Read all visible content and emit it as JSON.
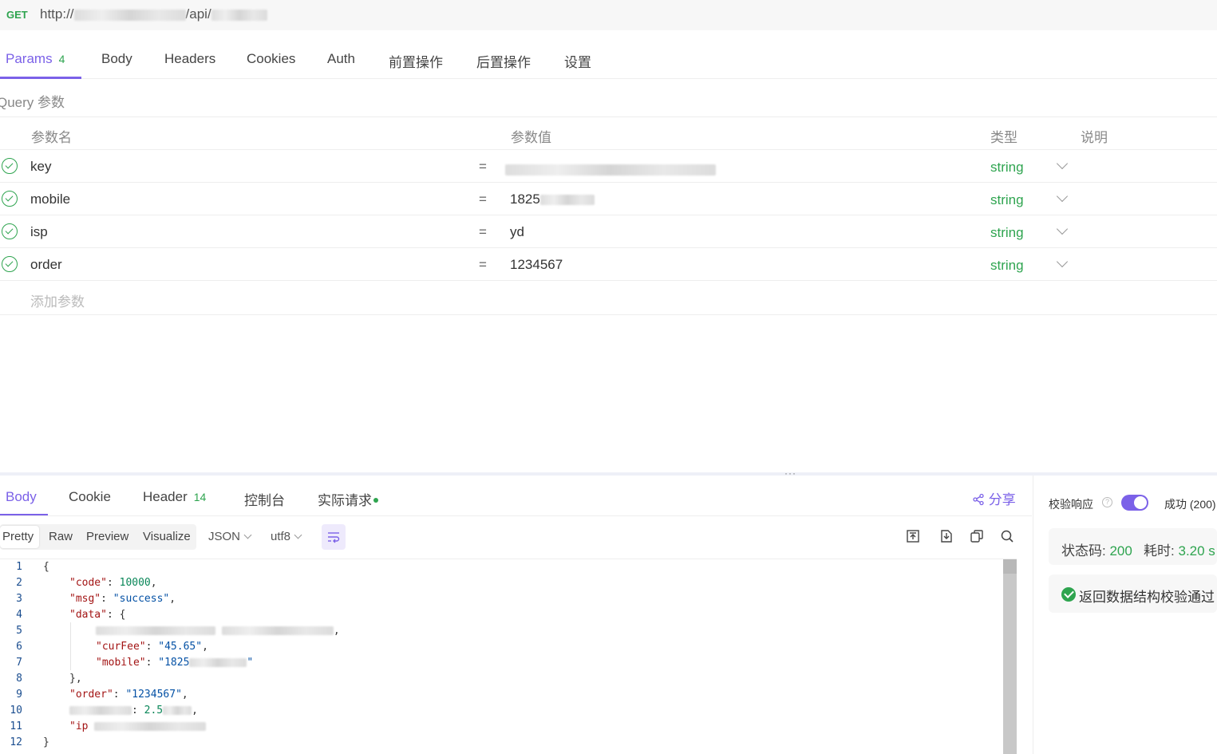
{
  "request": {
    "method": "GET",
    "url_prefix": "http://",
    "url_mid": "/api/"
  },
  "req_tabs": [
    {
      "label": "Params",
      "badge": "4"
    },
    {
      "label": "Body"
    },
    {
      "label": "Headers"
    },
    {
      "label": "Cookies"
    },
    {
      "label": "Auth"
    },
    {
      "label": "前置操作"
    },
    {
      "label": "后置操作"
    },
    {
      "label": "设置"
    }
  ],
  "query_label": "Query 参数",
  "columns": {
    "name": "参数名",
    "value": "参数值",
    "type": "类型",
    "desc": "说明"
  },
  "params": [
    {
      "name": "key",
      "eq": "=",
      "value": "",
      "type": "string"
    },
    {
      "name": "mobile",
      "eq": "=",
      "value": "1825",
      "type": "string"
    },
    {
      "name": "isp",
      "eq": "=",
      "value": "yd",
      "type": "string"
    },
    {
      "name": "order",
      "eq": "=",
      "value": "1234567",
      "type": "string"
    }
  ],
  "add_param": "添加参数",
  "resp_tabs": [
    {
      "label": "Body"
    },
    {
      "label": "Cookie"
    },
    {
      "label": "Header",
      "badge": "14"
    },
    {
      "label": "控制台"
    },
    {
      "label": "实际请求"
    }
  ],
  "share_label": "分享",
  "view_modes": [
    "Pretty",
    "Raw",
    "Preview",
    "Visualize"
  ],
  "format_select": "JSON",
  "encoding_select": "utf8",
  "code_lines": [
    "1",
    "2",
    "3",
    "4",
    "5",
    "6",
    "7",
    "8",
    "9",
    "10",
    "11",
    "12"
  ],
  "code": {
    "l1": "{",
    "l2_key": "\"code\"",
    "l2_val": "10000",
    "l3_key": "\"msg\"",
    "l3_val": "\"success\"",
    "l4_key": "\"data\"",
    "l4_rest": ": {",
    "l6_key": "\"curFee\"",
    "l6_val": "\"45.65\"",
    "l7_key": "\"mobile\"",
    "l7_val": "\"1825",
    "l8": "},",
    "l9_key": "\"order\"",
    "l9_val": "\"1234567\"",
    "l10_val": "2.5",
    "l11_key": "\"ip",
    "l12": "}"
  },
  "right_panel": {
    "verify_label": "校验响应",
    "result_label": "成功 (200)",
    "status_label": "状态码:",
    "status_value": "200",
    "time_label": "耗时:",
    "time_value": "3.20 s",
    "check_text": "返回数据结构校验通过"
  },
  "colors": {
    "accent": "#7b61e8",
    "success": "#2ea44f"
  }
}
